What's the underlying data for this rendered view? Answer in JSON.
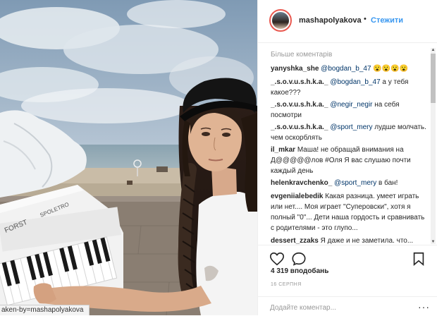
{
  "post": {
    "username": "mashapolyakova",
    "separator": "•",
    "follow_label": "Стежити",
    "more_comments": "Більше коментарів",
    "comments": [
      {
        "user": "yanyshka_she",
        "mention": "@bogdan_b_47",
        "text": " 😮😮😮😮"
      },
      {
        "user": "_.s.o.v.u.s.h.k.a._",
        "mention": "@bogdan_b_47",
        "text": " а у тебя какое???"
      },
      {
        "user": "_.s.o.v.u.s.h.k.a._",
        "mention": "@negir_negir",
        "text": " на себя посмотри"
      },
      {
        "user": "_.s.o.v.u.s.h.k.a._",
        "mention": "@sport_mery",
        "text": " лудше молчать. чем оскорблять"
      },
      {
        "user": "il_mkar",
        "mention": "",
        "text": "Маша! не обращай внимания на Д@@@@@лов #Оля Я вас слушаю почти каждый день"
      },
      {
        "user": "helenkravchenko_",
        "mention": "@sport_mery",
        "text": " в бан!"
      },
      {
        "user": "evgeniialebedik",
        "mention": "",
        "text": "Какая разница. умеет играть или нет.... Моя играет \"Суперовски\", хотя я полный \"0\"... Дети наша гордость и сравнивать с родителями - это глупо..."
      },
      {
        "user": "dessert_zzaks",
        "mention": "",
        "text": "Я даже и не заметила. что..."
      }
    ],
    "likes": "4 319 вподобань",
    "date": "16 СЕРПНЯ",
    "add_comment_placeholder": "Додайте коментар...",
    "status_url": "aken-by=mashapolyakova"
  },
  "photo": {
    "piano_brand": "FORST",
    "piano_brand2": "SPOLETRO"
  }
}
